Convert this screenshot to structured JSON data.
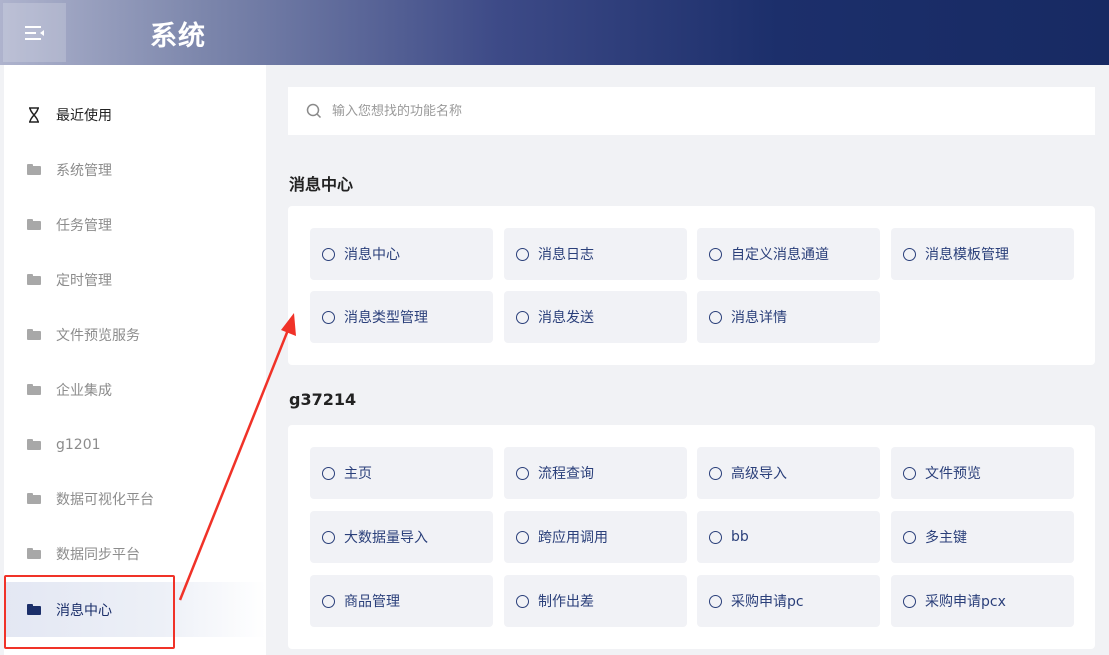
{
  "header": {
    "title": "系统"
  },
  "sidebar": {
    "items": [
      {
        "label": "最近使用"
      },
      {
        "label": "系统管理"
      },
      {
        "label": "任务管理"
      },
      {
        "label": "定时管理"
      },
      {
        "label": "文件预览服务"
      },
      {
        "label": "企业集成"
      },
      {
        "label": "g1201"
      },
      {
        "label": "数据可视化平台"
      },
      {
        "label": "数据同步平台"
      },
      {
        "label": "消息中心"
      }
    ],
    "active_label": "消息中心"
  },
  "search": {
    "placeholder": "输入您想找的功能名称"
  },
  "sections": [
    {
      "title": "消息中心",
      "items": [
        "消息中心",
        "消息日志",
        "自定义消息通道",
        "消息模板管理",
        "消息类型管理",
        "消息发送",
        "消息详情"
      ]
    },
    {
      "title": "g37214",
      "items": [
        "主页",
        "流程查询",
        "高级导入",
        "文件预览",
        "大数据量导入",
        "跨应用调用",
        "bb",
        "多主键",
        "商品管理",
        "制作出差",
        "采购申请pc",
        "采购申请pcx"
      ]
    }
  ],
  "colors": {
    "accent": "#1b2f6a",
    "annotation": "#f03228"
  }
}
